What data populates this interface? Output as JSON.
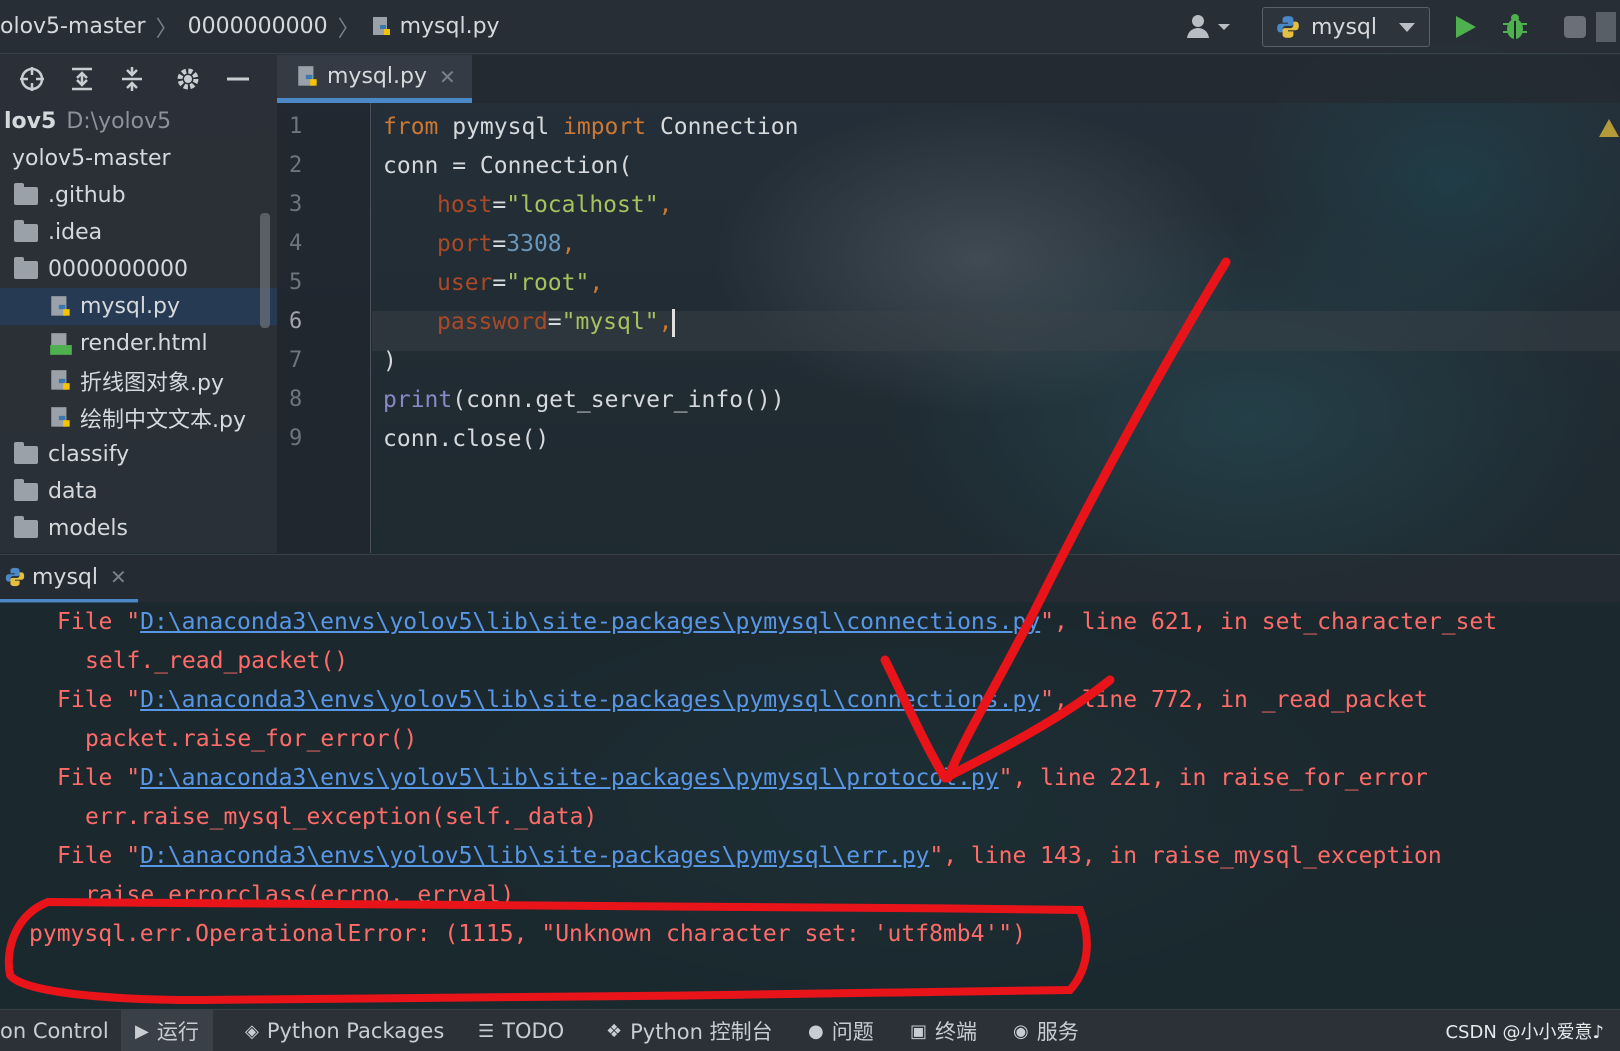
{
  "navbar": {
    "breadcrumbs": [
      "olov5-master",
      "0000000000",
      "mysql.py"
    ],
    "run_config": "mysql"
  },
  "project_toolbar": {
    "icons": [
      "target-icon",
      "expand-all-icon",
      "collapse-all-icon",
      "gear-icon",
      "minimize-icon"
    ]
  },
  "editor": {
    "tab_label": "mysql.py",
    "line_numbers": [
      "1",
      "2",
      "3",
      "4",
      "5",
      "6",
      "7",
      "8",
      "9"
    ],
    "lines": {
      "l1_kw1": "from",
      "l1_mod": " pymysql ",
      "l1_kw2": "import",
      "l1_name": " Connection",
      "l2": "conn = Connection(",
      "l3_param": "host",
      "l3_eq": "=",
      "l3_str": "\"localhost\"",
      "l3_comma": ",",
      "l4_param": "port",
      "l4_eq": "=",
      "l4_num": "3308",
      "l4_comma": ",",
      "l5_param": "user",
      "l5_eq": "=",
      "l5_str": "\"root\"",
      "l5_comma": ",",
      "l6_param": "password",
      "l6_eq": "=",
      "l6_str": "\"mysql\"",
      "l6_comma": ",",
      "l7": ")",
      "l8_builtin": "print",
      "l8_rest": "(conn.get_server_info())",
      "l9": "conn.close()"
    }
  },
  "project_tree": {
    "root_name": "lov5",
    "root_path": "D:\\yolov5",
    "items": [
      {
        "label": "yolov5-master"
      },
      {
        "label": ".github"
      },
      {
        "label": ".idea"
      },
      {
        "label": "0000000000"
      },
      {
        "label": "mysql.py"
      },
      {
        "label": "render.html"
      },
      {
        "label": "折线图对象.py"
      },
      {
        "label": "绘制中文文本.py"
      },
      {
        "label": "classify"
      },
      {
        "label": "data"
      },
      {
        "label": "models"
      }
    ]
  },
  "run_panel": {
    "tab_label": "mysql",
    "console": {
      "f1_pre": "File \"",
      "f1_link": "D:\\anaconda3\\envs\\yolov5\\lib\\site-packages\\pymysql\\connections.py",
      "f1_post": "\", line 621, in set_character_set",
      "c1": "self._read_packet()",
      "f2_pre": "File \"",
      "f2_link": "D:\\anaconda3\\envs\\yolov5\\lib\\site-packages\\pymysql\\connections.py",
      "f2_post": "\", line 772, in _read_packet",
      "c2": "packet.raise_for_error()",
      "f3_pre": "File \"",
      "f3_link": "D:\\anaconda3\\envs\\yolov5\\lib\\site-packages\\pymysql\\protocol.py",
      "f3_post": "\", line 221, in raise_for_error",
      "c3": "err.raise_mysql_exception(self._data)",
      "f4_pre": "File \"",
      "f4_link": "D:\\anaconda3\\envs\\yolov5\\lib\\site-packages\\pymysql\\err.py",
      "f4_post": "\", line 143, in raise_mysql_exception",
      "c4": "raise errorclass(errno, errval)",
      "error": "pymysql.err.OperationalError: (1115, \"Unknown character set: 'utf8mb4'\")"
    }
  },
  "bottom_bar": {
    "items": [
      "on Control",
      "运行",
      "Python Packages",
      "TODO",
      "Python 控制台",
      "问题",
      "终端",
      "服务"
    ],
    "watermark": "CSDN @小小爱意♪"
  },
  "colors": {
    "keyword": "#cc7832",
    "string": "#a5c25c",
    "number": "#6897bb",
    "error_text": "#ff6b68",
    "link": "#5896e6",
    "annotation": "#e8141a",
    "tab_accent": "#4a88c7"
  }
}
